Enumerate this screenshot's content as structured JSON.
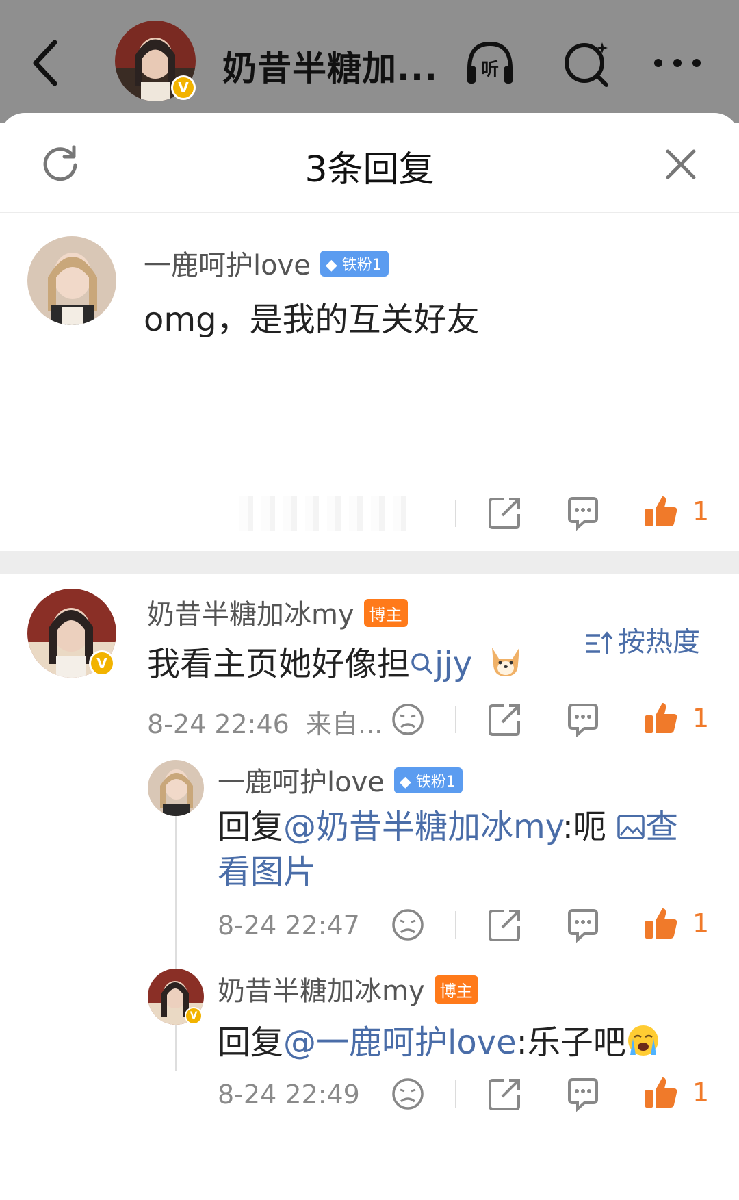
{
  "topbar": {
    "title": "奶昔半糖加...",
    "listen_label": "听"
  },
  "sheet": {
    "title": "3条回复"
  },
  "root_comment": {
    "username": "一鹿呵护love",
    "badge": "铁粉1",
    "text": "omg，是我的互关好友",
    "likes": "1"
  },
  "sort": {
    "label": "按热度"
  },
  "replies": [
    {
      "username": "奶昔半糖加冰my",
      "badge": "博主",
      "text_prefix": "我看主页她好像担",
      "topic": "jjy",
      "time": "8-24 22:46",
      "source": "来自...",
      "likes": "1"
    },
    {
      "username": "一鹿呵护love",
      "badge": "铁粉1",
      "reply_label": "回复",
      "mention": "@奶昔半糖加冰my",
      "text": ":呃",
      "image_link_a": "查",
      "image_link_b": "看图片",
      "time": "8-24 22:47",
      "likes": "1"
    },
    {
      "username": "奶昔半糖加冰my",
      "badge": "博主",
      "reply_label": "回复",
      "mention": "@一鹿呵护love",
      "text": ":乐子吧",
      "time": "8-24 22:49",
      "likes": "1"
    }
  ],
  "colors": {
    "accent_link": "#4a6da8",
    "like_orange": "#f07a2a",
    "fan_badge": "#5b9cf0",
    "blogger_badge": "#ff7a1a",
    "verified": "#f2b300"
  }
}
